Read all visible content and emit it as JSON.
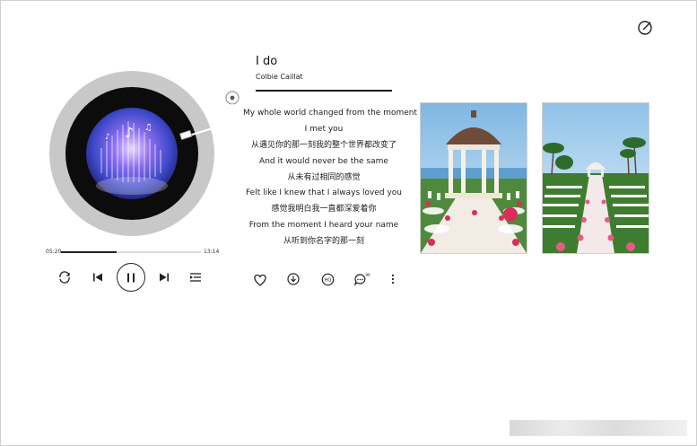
{
  "song": {
    "title": "I do",
    "artist": "Colbie Caillat"
  },
  "lyrics": [
    "My whole world changed from the moment",
    "I met you",
    "从遇见你的那一刻我的整个世界都改变了",
    "And it would never be the same",
    "从未有过相同的感觉",
    "Felt like I knew that I always loved you",
    "感觉我明白我一直都深爱着你",
    "From the moment I heard your name",
    "从听到你名字的那一刻"
  ],
  "player": {
    "elapsed": "05:20",
    "duration": "13:14",
    "progress": 0.4
  },
  "icons": {
    "top_right": "edit-icon",
    "controls": [
      "repeat-icon",
      "previous-icon",
      "pause-icon",
      "next-icon",
      "playlist-icon"
    ],
    "actions": [
      "heart-icon",
      "download-icon",
      "sound-quality-icon",
      "comment-icon",
      "more-icon"
    ]
  },
  "comment_badge": "99",
  "quality_label": "HQ",
  "colors": {
    "turntable_outer": "#c8c8c8",
    "record": "#0c0c0c",
    "accent": "#222222"
  }
}
